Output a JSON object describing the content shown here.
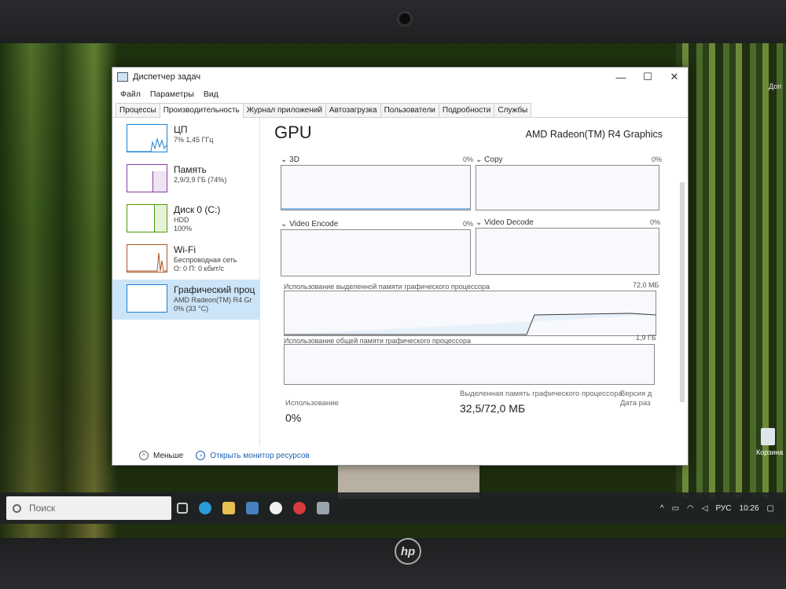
{
  "window": {
    "title": "Диспетчер задач",
    "controls": [
      "—",
      "☐",
      "✕"
    ]
  },
  "menu": [
    "Файл",
    "Параметры",
    "Вид"
  ],
  "tabs": [
    "Процессы",
    "Производительность",
    "Журнал приложений",
    "Автозагрузка",
    "Пользователи",
    "Подробности",
    "Службы"
  ],
  "sidebar": [
    {
      "title": "ЦП",
      "line1": "7% 1,45 ГГц",
      "line2": "",
      "color": "#1c7fd6"
    },
    {
      "title": "Память",
      "line1": "2,9/3,9 ГБ (74%)",
      "line2": "",
      "color": "#8b3aa8"
    },
    {
      "title": "Диск 0 (C:)",
      "line1": "HDD",
      "line2": "100%",
      "color": "#4e9a06"
    },
    {
      "title": "Wi-Fi",
      "line1": "Беспроводная сеть",
      "line2": "О: 0 П: 0 кбит/с",
      "color": "#a8572a"
    },
    {
      "title": "Графический проц",
      "line1": "AMD Radeon(TM) R4 Gr",
      "line2": "0% (33 °C)",
      "color": "#1c7fd6"
    }
  ],
  "main": {
    "title": "GPU",
    "adapter": "AMD Radeon(TM) R4 Graphics",
    "graphs": [
      {
        "label": "3D",
        "pct": "0%"
      },
      {
        "label": "Copy",
        "pct": "0%"
      },
      {
        "label": "Video Encode",
        "pct": "0%"
      },
      {
        "label": "Video Decode",
        "pct": "0%"
      }
    ],
    "dedicated_label": "Использование выделенной памяти графического процессора",
    "dedicated_max": "72,0 МБ",
    "shared_label": "Использование общей памяти графического процессора",
    "shared_max": "1,9 ГБ",
    "usage_label": "Использование",
    "usage_value": "0%",
    "dedicated_mem_label": "Выделенная память графического процессора",
    "dedicated_mem_value": "32,5/72,0 МБ",
    "version_label": "Версия д",
    "date_label": "Дата раз"
  },
  "footer": {
    "less": "Меньше",
    "monitor": "Открыть монитор ресурсов"
  },
  "taskbar": {
    "search_placeholder": "Поиск",
    "lang": "РУС",
    "time": "10:26"
  },
  "desktop": {
    "recycle_bin": "Корзина",
    "side_text": "Доп"
  }
}
